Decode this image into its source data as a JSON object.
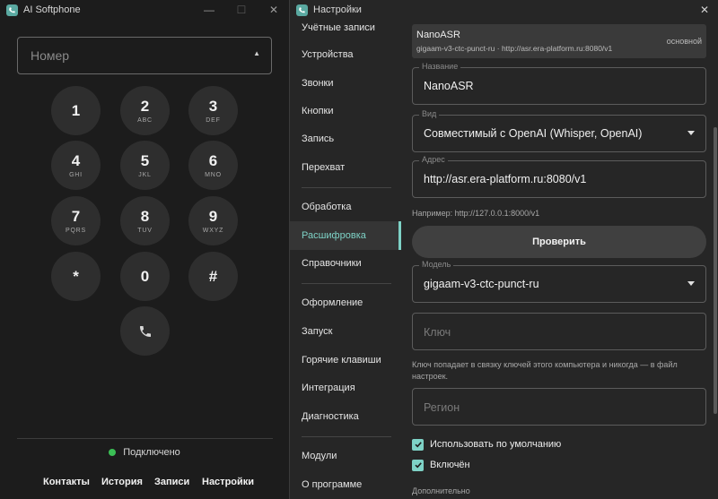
{
  "phone_window": {
    "title": "AI Softphone",
    "controls": {
      "minimize": "—",
      "maximize": "☐",
      "close": "✕"
    },
    "number_input": {
      "placeholder": "Номер",
      "value": ""
    },
    "dropdown_arrow": "▲",
    "keypad": [
      {
        "digit": "1",
        "letters": ""
      },
      {
        "digit": "2",
        "letters": "ABC"
      },
      {
        "digit": "3",
        "letters": "DEF"
      },
      {
        "digit": "4",
        "letters": "GHI"
      },
      {
        "digit": "5",
        "letters": "JKL"
      },
      {
        "digit": "6",
        "letters": "MNO"
      },
      {
        "digit": "7",
        "letters": "PQRS"
      },
      {
        "digit": "8",
        "letters": "TUV"
      },
      {
        "digit": "9",
        "letters": "WXYZ"
      },
      {
        "digit": "*",
        "letters": ""
      },
      {
        "digit": "0",
        "letters": ""
      },
      {
        "digit": "#",
        "letters": ""
      }
    ],
    "call_icon": "phone-icon",
    "status": {
      "text": "Подключено",
      "color": "#3bbf55"
    },
    "nav": [
      "Контакты",
      "История",
      "Записи",
      "Настройки"
    ]
  },
  "settings_window": {
    "title": "Настройки",
    "close": "✕",
    "accent": "#7ed2c6",
    "sidebar": [
      "Учётные записи",
      "Устройства",
      "Звонки",
      "Кнопки",
      "Запись",
      "Перехват",
      "Обработка",
      "Расшифровка",
      "Справочники",
      "Оформление",
      "Запуск",
      "Горячие клавиши",
      "Интеграция",
      "Диагностика",
      "Модули",
      "О программе"
    ],
    "active_item": "Расшифровка",
    "provider": {
      "name": "NanoASR",
      "description": "gigaam-v3-ctc-punct-ru · http://asr.era-platform.ru:8080/v1",
      "badge": "основной"
    },
    "fields": {
      "name": {
        "label": "Название",
        "value": "NanoASR"
      },
      "kind": {
        "label": "Вид",
        "value": "Совместимый с OpenAI (Whisper, OpenAI)"
      },
      "address": {
        "label": "Адрес",
        "value": "http://asr.era-platform.ru:8080/v1"
      },
      "address_hint": "Например: http://127.0.0.1:8000/v1",
      "check_button": "Проверить",
      "model": {
        "label": "Модель",
        "value": "gigaam-v3-ctc-punct-ru"
      },
      "key": {
        "placeholder": "Ключ"
      },
      "key_hint": "Ключ попадает в связку ключей этого компьютера и никогда — в файл настроек.",
      "region": {
        "placeholder": "Регион"
      }
    },
    "checkboxes": [
      {
        "label": "Использовать по умолчанию",
        "checked": true
      },
      {
        "label": "Включён",
        "checked": true
      }
    ],
    "advanced_label": "Дополнительно"
  }
}
